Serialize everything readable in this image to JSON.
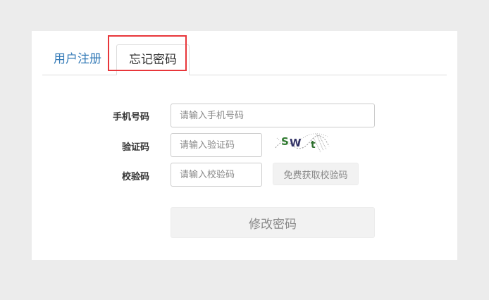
{
  "tabs": {
    "register": "用户注册",
    "forgot": "忘记密码"
  },
  "form": {
    "phone": {
      "label": "手机号码",
      "placeholder": "请输入手机号码"
    },
    "captcha": {
      "label": "验证码",
      "placeholder": "请输入验证码",
      "image_text": "SWt"
    },
    "verify": {
      "label": "校验码",
      "placeholder": "请输入校验码",
      "button": "免费获取校验码"
    },
    "submit": "修改密码"
  }
}
